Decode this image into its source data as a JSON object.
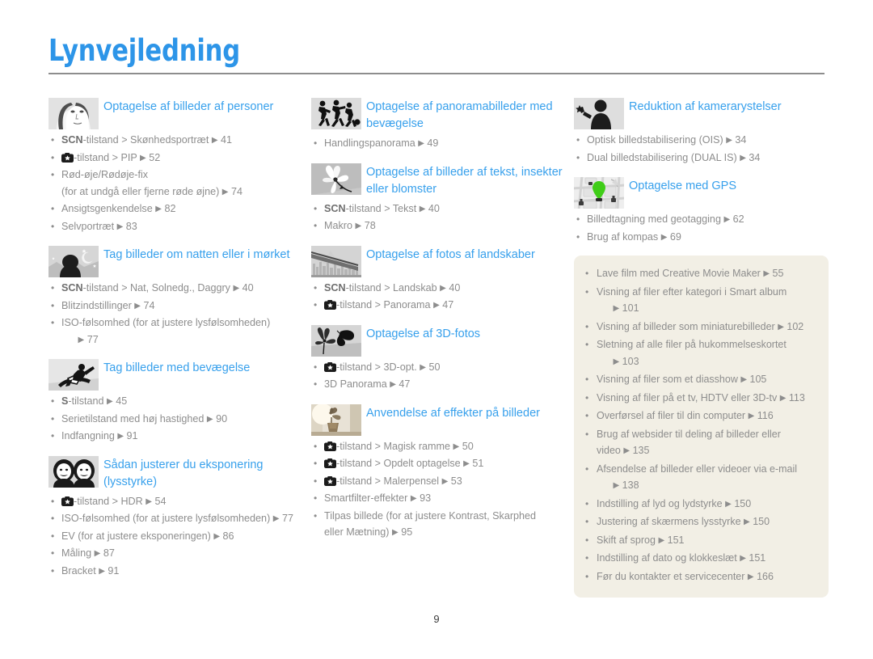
{
  "document": {
    "title": "Lynvejledning",
    "page_number": "9",
    "accent_color": "#2d95e8",
    "title_link_color": "#37a0ec",
    "body_text_color": "#8d8d8d",
    "cream_box_color": "#f2efe5",
    "rule_color": "#8d8d8d"
  },
  "columns": [
    {
      "sections": [
        {
          "icon": "portrait-woman-thumbnail",
          "title": "Optagelse af billeder af personer",
          "items": [
            {
              "strong": "SCN",
              "text": "-tilstand > Skønhedsportræt",
              "arrow": "▶",
              "page": "41"
            },
            {
              "icon": "camera-mode-icon",
              "text": "-tilstand > PIP",
              "arrow": "▶",
              "page": "52"
            },
            {
              "text": "Rød-øje/Rødøje-fix"
            },
            {
              "cont": "(for at undgå eller fjerne røde øjne)",
              "arrow": "▶",
              "page": "74"
            },
            {
              "text": "Ansigtsgenkendelse",
              "arrow": "▶",
              "page": "82"
            },
            {
              "text": "Selvportræt",
              "arrow": "▶",
              "page": "83"
            }
          ]
        },
        {
          "icon": "night-scene-thumbnail",
          "title": "Tag billeder om natten eller i mørket",
          "items": [
            {
              "strong": "SCN",
              "text": "-tilstand > Nat, Solnedg., Daggry",
              "arrow": "▶",
              "page": "40"
            },
            {
              "text": "Blitzindstillinger",
              "arrow": "▶",
              "page": "74"
            },
            {
              "text": "ISO-følsomhed (for at justere lysfølsomheden)"
            },
            {
              "cont_arrow": true,
              "arrow": "▶",
              "page": "77"
            }
          ]
        },
        {
          "icon": "snowboarder-thumbnail",
          "title": "Tag billeder med bevægelse",
          "items": [
            {
              "strong": "S",
              "text": "-tilstand",
              "arrow": "▶",
              "page": "45"
            },
            {
              "text": "Serietilstand med høj hastighed",
              "arrow": "▶",
              "page": "90"
            },
            {
              "text": "Indfangning",
              "arrow": "▶",
              "page": "91"
            }
          ]
        },
        {
          "icon": "two-faces-thumbnail",
          "title": "Sådan justerer du eksponering (lysstyrke)",
          "items": [
            {
              "icon": "camera-mode-icon",
              "text": "-tilstand > HDR",
              "arrow": "▶",
              "page": "54"
            },
            {
              "text": "ISO-følsomhed (for at justere lysfølsomheden)",
              "arrow": "▶",
              "page": "77"
            },
            {
              "text": "EV (for at justere eksponeringen)",
              "arrow": "▶",
              "page": "86"
            },
            {
              "text": "Måling",
              "arrow": "▶",
              "page": "87"
            },
            {
              "text": "Bracket",
              "arrow": "▶",
              "page": "91"
            }
          ]
        }
      ]
    },
    {
      "sections": [
        {
          "icon": "running-people-thumbnail",
          "title": "Optagelse af panoramabilleder med bevægelse",
          "items": [
            {
              "text": "Handlingspanorama",
              "arrow": "▶",
              "page": "49"
            }
          ]
        },
        {
          "icon": "flower-macro-thumbnail",
          "title": "Optagelse af billeder af tekst, insekter eller blomster",
          "items": [
            {
              "strong": "SCN",
              "text": "-tilstand > Tekst",
              "arrow": "▶",
              "page": "40"
            },
            {
              "text": "Makro",
              "arrow": "▶",
              "page": "78"
            }
          ]
        },
        {
          "icon": "landscape-bridge-thumbnail",
          "title": "Optagelse af fotos af landskaber",
          "items": [
            {
              "strong": "SCN",
              "text": "-tilstand > Landskab",
              "arrow": "▶",
              "page": "40"
            },
            {
              "icon": "camera-mode-icon",
              "text": "-tilstand > Panorama",
              "arrow": "▶",
              "page": "47"
            }
          ]
        },
        {
          "icon": "butterfly-3d-thumbnail",
          "title": "Optagelse af 3D-fotos",
          "items": [
            {
              "icon": "camera-mode-icon",
              "text": "-tilstand > 3D-opt.",
              "arrow": "▶",
              "page": "50"
            },
            {
              "text": "3D Panorama",
              "arrow": "▶",
              "page": "47"
            }
          ]
        },
        {
          "icon": "vase-effects-thumbnail",
          "title": "Anvendelse af effekter på billeder",
          "items": [
            {
              "icon": "camera-mode-icon",
              "text": "-tilstand > Magisk ramme",
              "arrow": "▶",
              "page": "50"
            },
            {
              "icon": "camera-mode-icon",
              "text": "-tilstand > Opdelt optagelse",
              "arrow": "▶",
              "page": "51"
            },
            {
              "icon": "camera-mode-icon",
              "text": "-tilstand > Malerpensel",
              "arrow": "▶",
              "page": "53"
            },
            {
              "text": "Smartfilter-effekter",
              "arrow": "▶",
              "page": "93"
            },
            {
              "text": "Tilpas billede (for at justere Kontrast, Skarphed"
            },
            {
              "cont": "eller Mætning)",
              "arrow": "▶",
              "page": "95"
            }
          ]
        }
      ]
    },
    {
      "sections": [
        {
          "icon": "person-steady-thumbnail",
          "title": "Reduktion af kamerarystelser",
          "items": [
            {
              "text": "Optisk billedstabilisering (OIS)",
              "arrow": "▶",
              "page": "34"
            },
            {
              "text": "Dual billedstabilisering (DUAL IS)",
              "arrow": "▶",
              "page": "34"
            }
          ]
        },
        {
          "icon": "gps-map-thumbnail",
          "title": "Optagelse med GPS",
          "items": [
            {
              "text": "Billedtagning med geotagging",
              "arrow": "▶",
              "page": "62"
            },
            {
              "text": "Brug af kompas",
              "arrow": "▶",
              "page": "69"
            }
          ]
        }
      ],
      "cream_box": {
        "items": [
          {
            "text": "Lave film med Creative Movie Maker",
            "arrow": "▶",
            "page": "55"
          },
          {
            "text": "Visning af filer efter kategori i Smart album"
          },
          {
            "cont_arrow": true,
            "arrow": "▶",
            "page": "101"
          },
          {
            "text": "Visning af billeder som miniaturebilleder",
            "arrow": "▶",
            "page": "102"
          },
          {
            "text": "Sletning af alle filer på hukommelseskortet"
          },
          {
            "cont_arrow": true,
            "arrow": "▶",
            "page": "103"
          },
          {
            "text": "Visning af filer som et diasshow",
            "arrow": "▶",
            "page": "105"
          },
          {
            "text": "Visning af filer på et tv, HDTV eller 3D-tv",
            "arrow": "▶",
            "page": "113"
          },
          {
            "text": "Overførsel af filer til din computer",
            "arrow": "▶",
            "page": "116"
          },
          {
            "text": "Brug af websider til deling af billeder eller"
          },
          {
            "cont": "video",
            "arrow": "▶",
            "page": "135"
          },
          {
            "text": "Afsendelse af billeder eller videoer via e-mail"
          },
          {
            "cont_arrow": true,
            "arrow": "▶",
            "page": "138"
          },
          {
            "text": "Indstilling af lyd og lydstyrke",
            "arrow": "▶",
            "page": "150"
          },
          {
            "text": "Justering af skærmens lysstyrke",
            "arrow": "▶",
            "page": "150"
          },
          {
            "text": "Skift af sprog",
            "arrow": "▶",
            "page": "151"
          },
          {
            "text": "Indstilling af dato og klokkeslæt",
            "arrow": "▶",
            "page": "151"
          },
          {
            "text": "Før du kontakter et servicecenter",
            "arrow": "▶",
            "page": "166"
          }
        ]
      }
    }
  ]
}
